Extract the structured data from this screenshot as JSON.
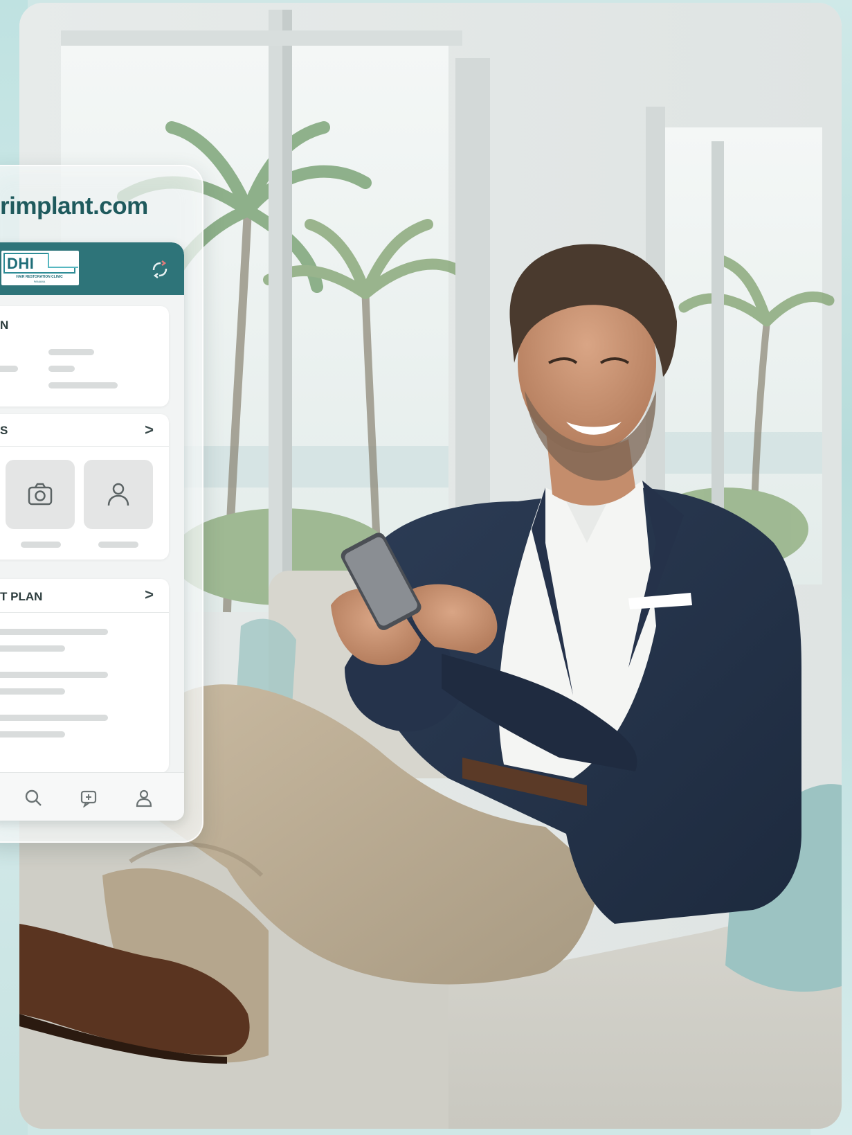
{
  "card": {
    "domain": "rimplant.com",
    "logo": {
      "brand": "DHI",
      "tagline": "HAIR RESTORATION CLINIC",
      "location": "PANAMA"
    },
    "icons": {
      "header": "sync-icon",
      "gallery_tiles": [
        "camera-icon",
        "user-icon"
      ],
      "bottom_nav": [
        "search-icon",
        "chat-icon",
        "profile-icon"
      ]
    },
    "sections": [
      {
        "title": "N",
        "has_chevron": false
      },
      {
        "title": "S",
        "has_chevron": true,
        "chevron": ">"
      },
      {
        "title": "T PLAN",
        "has_chevron": true,
        "chevron": ">"
      }
    ]
  },
  "colors": {
    "brand_teal": "#2e7479",
    "domain_text": "#1f5a5d",
    "background_mint": "#cfe7e6"
  }
}
